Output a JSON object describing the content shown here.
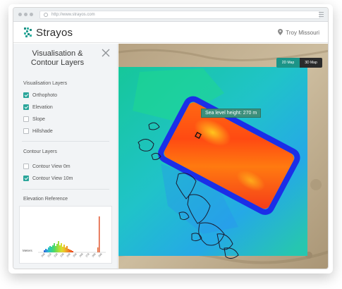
{
  "browser": {
    "url": "http://www.strayos.com"
  },
  "header": {
    "brand": "Strayos",
    "location": "Troy Missouri"
  },
  "sidebar": {
    "title_line1": "Visualisation &",
    "title_line2": "Contour Layers",
    "visualisation_heading": "Visualisation Layers",
    "visualisation_items": [
      {
        "label": "Orthophoto",
        "checked": true
      },
      {
        "label": "Elevation",
        "checked": true
      },
      {
        "label": "Slope",
        "checked": false
      },
      {
        "label": "Hillshade",
        "checked": false
      }
    ],
    "contour_heading": "Contour Layers",
    "contour_items": [
      {
        "label": "Contour View 0m",
        "checked": false
      },
      {
        "label": "Contour View 10m",
        "checked": true
      }
    ],
    "elevation_heading": "Elevation Reference",
    "histogram": {
      "ylabel": "Meters",
      "ticks": [
        "208",
        "218",
        "228",
        "238",
        "248",
        "258",
        "268",
        "278",
        "288",
        "298"
      ]
    }
  },
  "map": {
    "btn_2d": "2D Map",
    "btn_3d": "3D Map",
    "tooltip": "Sea level height: 270 m"
  },
  "colors": {
    "accent": "#2aa59a",
    "hot": "#ff4a1a",
    "cold": "#1bb6ff"
  }
}
